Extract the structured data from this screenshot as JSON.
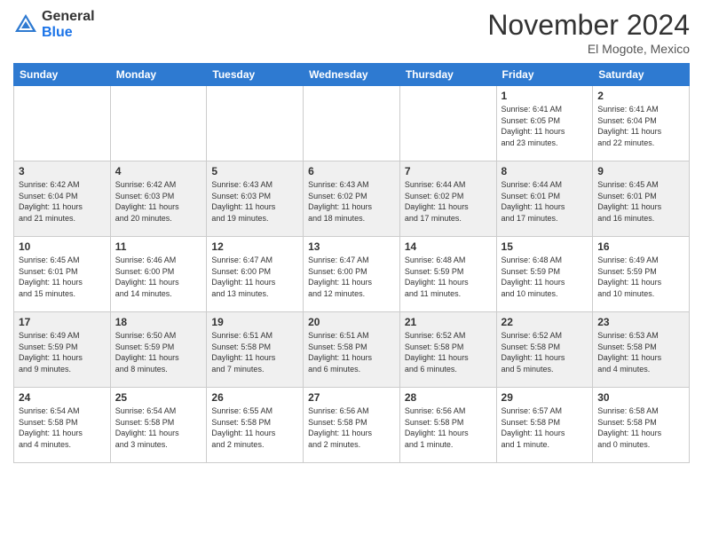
{
  "header": {
    "logo_general": "General",
    "logo_blue": "Blue",
    "month_title": "November 2024",
    "location": "El Mogote, Mexico"
  },
  "weekdays": [
    "Sunday",
    "Monday",
    "Tuesday",
    "Wednesday",
    "Thursday",
    "Friday",
    "Saturday"
  ],
  "weeks": [
    [
      {
        "day": "",
        "info": ""
      },
      {
        "day": "",
        "info": ""
      },
      {
        "day": "",
        "info": ""
      },
      {
        "day": "",
        "info": ""
      },
      {
        "day": "",
        "info": ""
      },
      {
        "day": "1",
        "info": "Sunrise: 6:41 AM\nSunset: 6:05 PM\nDaylight: 11 hours\nand 23 minutes."
      },
      {
        "day": "2",
        "info": "Sunrise: 6:41 AM\nSunset: 6:04 PM\nDaylight: 11 hours\nand 22 minutes."
      }
    ],
    [
      {
        "day": "3",
        "info": "Sunrise: 6:42 AM\nSunset: 6:04 PM\nDaylight: 11 hours\nand 21 minutes."
      },
      {
        "day": "4",
        "info": "Sunrise: 6:42 AM\nSunset: 6:03 PM\nDaylight: 11 hours\nand 20 minutes."
      },
      {
        "day": "5",
        "info": "Sunrise: 6:43 AM\nSunset: 6:03 PM\nDaylight: 11 hours\nand 19 minutes."
      },
      {
        "day": "6",
        "info": "Sunrise: 6:43 AM\nSunset: 6:02 PM\nDaylight: 11 hours\nand 18 minutes."
      },
      {
        "day": "7",
        "info": "Sunrise: 6:44 AM\nSunset: 6:02 PM\nDaylight: 11 hours\nand 17 minutes."
      },
      {
        "day": "8",
        "info": "Sunrise: 6:44 AM\nSunset: 6:01 PM\nDaylight: 11 hours\nand 17 minutes."
      },
      {
        "day": "9",
        "info": "Sunrise: 6:45 AM\nSunset: 6:01 PM\nDaylight: 11 hours\nand 16 minutes."
      }
    ],
    [
      {
        "day": "10",
        "info": "Sunrise: 6:45 AM\nSunset: 6:01 PM\nDaylight: 11 hours\nand 15 minutes."
      },
      {
        "day": "11",
        "info": "Sunrise: 6:46 AM\nSunset: 6:00 PM\nDaylight: 11 hours\nand 14 minutes."
      },
      {
        "day": "12",
        "info": "Sunrise: 6:47 AM\nSunset: 6:00 PM\nDaylight: 11 hours\nand 13 minutes."
      },
      {
        "day": "13",
        "info": "Sunrise: 6:47 AM\nSunset: 6:00 PM\nDaylight: 11 hours\nand 12 minutes."
      },
      {
        "day": "14",
        "info": "Sunrise: 6:48 AM\nSunset: 5:59 PM\nDaylight: 11 hours\nand 11 minutes."
      },
      {
        "day": "15",
        "info": "Sunrise: 6:48 AM\nSunset: 5:59 PM\nDaylight: 11 hours\nand 10 minutes."
      },
      {
        "day": "16",
        "info": "Sunrise: 6:49 AM\nSunset: 5:59 PM\nDaylight: 11 hours\nand 10 minutes."
      }
    ],
    [
      {
        "day": "17",
        "info": "Sunrise: 6:49 AM\nSunset: 5:59 PM\nDaylight: 11 hours\nand 9 minutes."
      },
      {
        "day": "18",
        "info": "Sunrise: 6:50 AM\nSunset: 5:59 PM\nDaylight: 11 hours\nand 8 minutes."
      },
      {
        "day": "19",
        "info": "Sunrise: 6:51 AM\nSunset: 5:58 PM\nDaylight: 11 hours\nand 7 minutes."
      },
      {
        "day": "20",
        "info": "Sunrise: 6:51 AM\nSunset: 5:58 PM\nDaylight: 11 hours\nand 6 minutes."
      },
      {
        "day": "21",
        "info": "Sunrise: 6:52 AM\nSunset: 5:58 PM\nDaylight: 11 hours\nand 6 minutes."
      },
      {
        "day": "22",
        "info": "Sunrise: 6:52 AM\nSunset: 5:58 PM\nDaylight: 11 hours\nand 5 minutes."
      },
      {
        "day": "23",
        "info": "Sunrise: 6:53 AM\nSunset: 5:58 PM\nDaylight: 11 hours\nand 4 minutes."
      }
    ],
    [
      {
        "day": "24",
        "info": "Sunrise: 6:54 AM\nSunset: 5:58 PM\nDaylight: 11 hours\nand 4 minutes."
      },
      {
        "day": "25",
        "info": "Sunrise: 6:54 AM\nSunset: 5:58 PM\nDaylight: 11 hours\nand 3 minutes."
      },
      {
        "day": "26",
        "info": "Sunrise: 6:55 AM\nSunset: 5:58 PM\nDaylight: 11 hours\nand 2 minutes."
      },
      {
        "day": "27",
        "info": "Sunrise: 6:56 AM\nSunset: 5:58 PM\nDaylight: 11 hours\nand 2 minutes."
      },
      {
        "day": "28",
        "info": "Sunrise: 6:56 AM\nSunset: 5:58 PM\nDaylight: 11 hours\nand 1 minute."
      },
      {
        "day": "29",
        "info": "Sunrise: 6:57 AM\nSunset: 5:58 PM\nDaylight: 11 hours\nand 1 minute."
      },
      {
        "day": "30",
        "info": "Sunrise: 6:58 AM\nSunset: 5:58 PM\nDaylight: 11 hours\nand 0 minutes."
      }
    ]
  ]
}
